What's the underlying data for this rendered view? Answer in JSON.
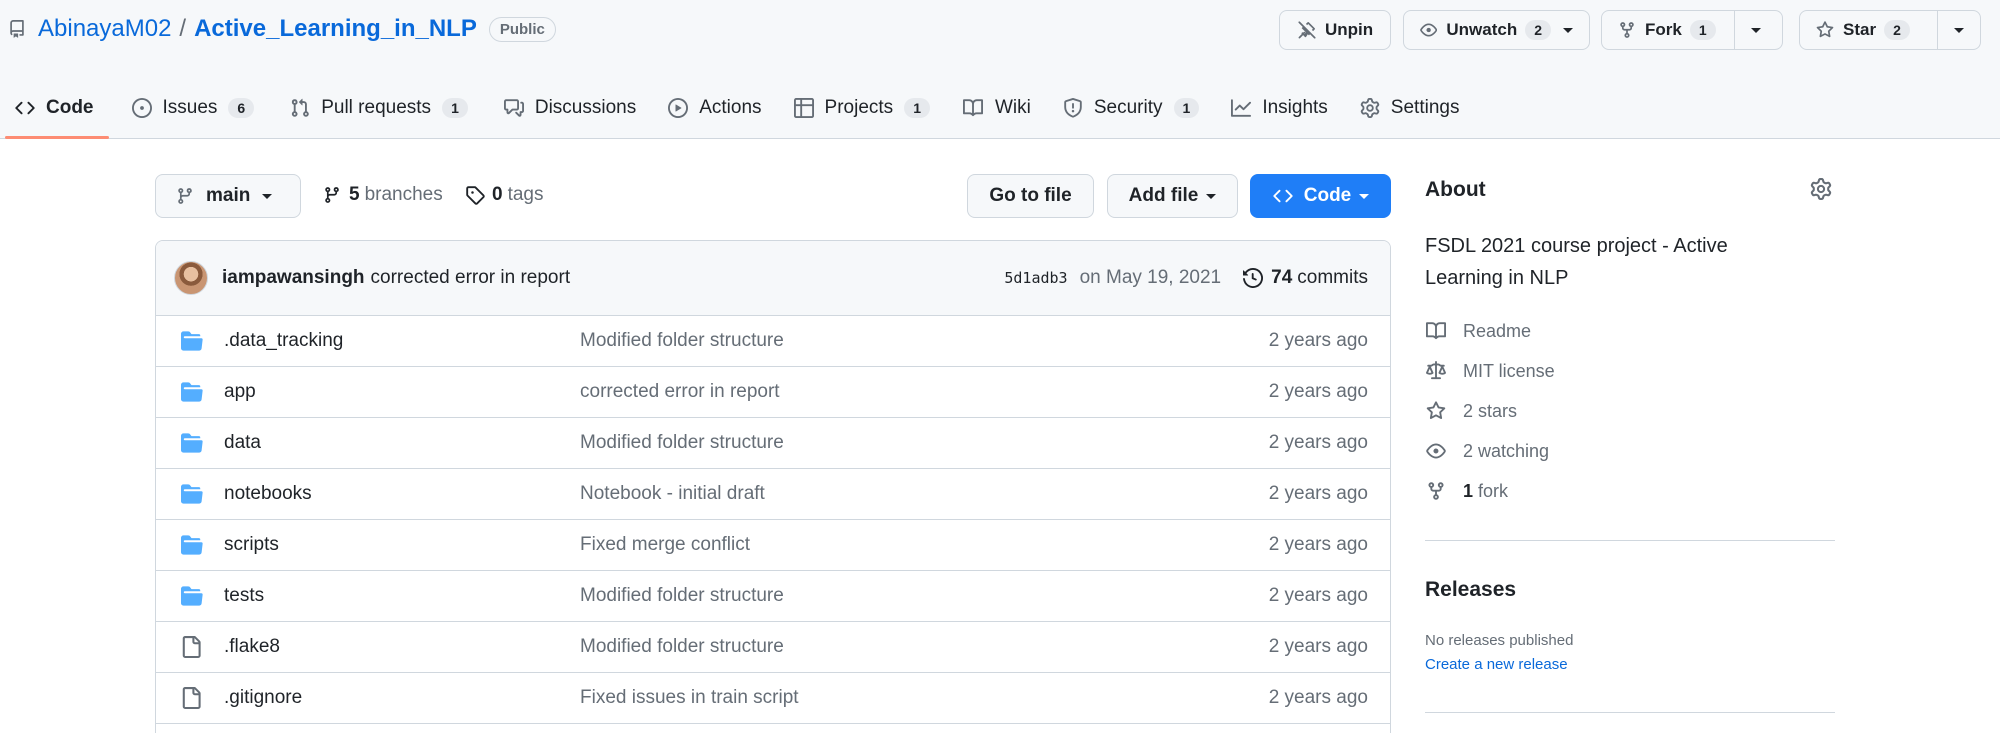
{
  "repo": {
    "owner": "AbinayaM02",
    "name": "Active_Learning_in_NLP",
    "visibility": "Public"
  },
  "actions": {
    "unpin": "Unpin",
    "watch": {
      "label": "Unwatch",
      "count": "2"
    },
    "fork": {
      "label": "Fork",
      "count": "1"
    },
    "star": {
      "label": "Star",
      "count": "2"
    }
  },
  "tabs": [
    {
      "label": "Code",
      "icon": "code-icon",
      "active": true
    },
    {
      "label": "Issues",
      "count": "6",
      "icon": "issue-icon"
    },
    {
      "label": "Pull requests",
      "count": "1",
      "icon": "pull-request-icon"
    },
    {
      "label": "Discussions",
      "icon": "comment-discussion-icon"
    },
    {
      "label": "Actions",
      "icon": "play-icon"
    },
    {
      "label": "Projects",
      "count": "1",
      "icon": "table-icon"
    },
    {
      "label": "Wiki",
      "icon": "book-icon"
    },
    {
      "label": "Security",
      "count": "1",
      "icon": "shield-icon"
    },
    {
      "label": "Insights",
      "icon": "graph-icon"
    },
    {
      "label": "Settings",
      "icon": "gear-icon"
    }
  ],
  "toolbar": {
    "branch": "main",
    "branches_count": "5",
    "branches_label": "branches",
    "tags_count": "0",
    "tags_label": "tags",
    "go_to_file": "Go to file",
    "add_file": "Add file",
    "code": "Code"
  },
  "latest_commit": {
    "author": "iampawansingh",
    "message": "corrected error in report",
    "sha": "5d1adb3",
    "date": "on May 19, 2021",
    "commits_count": "74",
    "commits_label": "commits"
  },
  "files": [
    {
      "type": "dir",
      "name": ".data_tracking",
      "message": "Modified folder structure",
      "age": "2 years ago"
    },
    {
      "type": "dir",
      "name": "app",
      "message": "corrected error in report",
      "age": "2 years ago"
    },
    {
      "type": "dir",
      "name": "data",
      "message": "Modified folder structure",
      "age": "2 years ago"
    },
    {
      "type": "dir",
      "name": "notebooks",
      "message": "Notebook - initial draft",
      "age": "2 years ago"
    },
    {
      "type": "dir",
      "name": "scripts",
      "message": "Fixed merge conflict",
      "age": "2 years ago"
    },
    {
      "type": "dir",
      "name": "tests",
      "message": "Modified folder structure",
      "age": "2 years ago"
    },
    {
      "type": "file",
      "name": ".flake8",
      "message": "Modified folder structure",
      "age": "2 years ago"
    },
    {
      "type": "file",
      "name": ".gitignore",
      "message": "Fixed issues in train script",
      "age": "2 years ago"
    }
  ],
  "about": {
    "heading": "About",
    "description": "FSDL 2021 course project - Active Learning in NLP",
    "readme": "Readme",
    "license": "MIT license",
    "stars": "2 stars",
    "watching": "2 watching",
    "forks_count": "1",
    "forks_label": "fork"
  },
  "releases": {
    "heading": "Releases",
    "none": "No releases published",
    "create": "Create a new release"
  },
  "colors": {
    "link": "#0969da",
    "primary_button": "#1f7ef7",
    "folder": "#54aeff",
    "active_tab_underline": "#fd8c73"
  }
}
